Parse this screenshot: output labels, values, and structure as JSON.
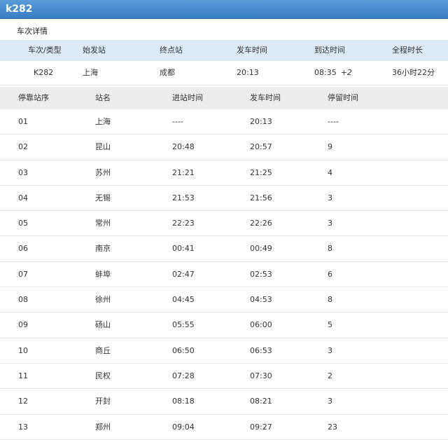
{
  "window": {
    "title": "k282"
  },
  "details": {
    "section_title": "车次详情",
    "headers": [
      "车次/类型",
      "始发站",
      "终点站",
      "发车时间",
      "到达时间",
      "全程时长"
    ],
    "row": {
      "train": "K282",
      "origin": "上海",
      "destination": "成都",
      "depart": "20:13",
      "arrive": "08:35",
      "arrive_offset": "+2",
      "duration": "36小时22分"
    }
  },
  "stops": {
    "headers": [
      "停靠站序",
      "站名",
      "进站时间",
      "发车时间",
      "停留时间"
    ],
    "rows": [
      [
        "01",
        "上海",
        "----",
        "20:13",
        "----"
      ],
      [
        "02",
        "昆山",
        "20:48",
        "20:57",
        "9"
      ],
      [
        "03",
        "苏州",
        "21:21",
        "21:25",
        "4"
      ],
      [
        "04",
        "无锡",
        "21:53",
        "21:56",
        "3"
      ],
      [
        "05",
        "常州",
        "22:23",
        "22:26",
        "3"
      ],
      [
        "06",
        "南京",
        "00:41",
        "00:49",
        "8"
      ],
      [
        "07",
        "蚌埠",
        "02:47",
        "02:53",
        "6"
      ],
      [
        "08",
        "徐州",
        "04:45",
        "04:53",
        "8"
      ],
      [
        "09",
        "砀山",
        "05:55",
        "06:00",
        "5"
      ],
      [
        "10",
        "商丘",
        "06:50",
        "06:53",
        "3"
      ],
      [
        "11",
        "民权",
        "07:28",
        "07:30",
        "2"
      ],
      [
        "12",
        "开封",
        "08:18",
        "08:21",
        "3"
      ],
      [
        "13",
        "郑州",
        "09:04",
        "09:27",
        "23"
      ]
    ]
  }
}
